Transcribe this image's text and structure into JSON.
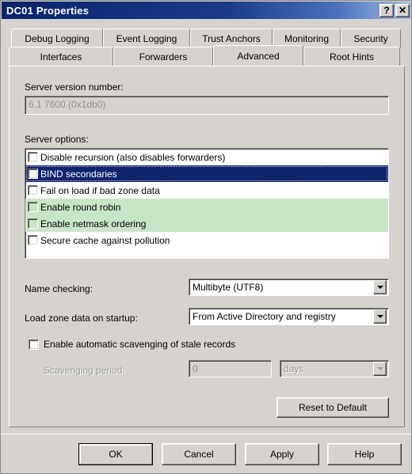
{
  "window": {
    "title": "DC01 Properties",
    "help_button": "?",
    "close_button": "✕"
  },
  "tabs": {
    "row1": [
      {
        "label": "Debug Logging",
        "active": false
      },
      {
        "label": "Event Logging",
        "active": false
      },
      {
        "label": "Trust Anchors",
        "active": false
      },
      {
        "label": "Monitoring",
        "active": false
      },
      {
        "label": "Security",
        "active": false
      }
    ],
    "row2": [
      {
        "label": "Interfaces",
        "active": false
      },
      {
        "label": "Forwarders",
        "active": false
      },
      {
        "label": "Advanced",
        "active": true
      },
      {
        "label": "Root Hints",
        "active": false
      }
    ],
    "active_tab": "Advanced"
  },
  "advanced": {
    "version_label": "Server version number:",
    "version_value": "6.1 7600 (0x1db0)",
    "options_label": "Server options:",
    "options": [
      {
        "label": "Disable recursion (also disables forwarders)",
        "checked": false,
        "state": "normal"
      },
      {
        "label": "BIND secondaries",
        "checked": false,
        "state": "selected"
      },
      {
        "label": "Fail on load if bad zone data",
        "checked": false,
        "state": "normal"
      },
      {
        "label": "Enable round robin",
        "checked": false,
        "state": "highlight"
      },
      {
        "label": "Enable netmask ordering",
        "checked": false,
        "state": "highlight"
      },
      {
        "label": "Secure cache against pollution",
        "checked": false,
        "state": "normal"
      }
    ],
    "name_checking_label": "Name checking:",
    "name_checking_value": "Multibyte (UTF8)",
    "load_zone_label": "Load zone data on startup:",
    "load_zone_value": "From Active Directory and registry",
    "scavenging_checkbox_label": "Enable automatic scavenging of stale records",
    "scavenging_checked": false,
    "scavenging_period_label": "Scavenging period:",
    "scavenging_period_value": "0",
    "scavenging_units_value": "days",
    "reset_button": "Reset to Default"
  },
  "footer": {
    "ok": "OK",
    "cancel": "Cancel",
    "apply": "Apply",
    "help": "Help"
  },
  "colors": {
    "titlebar_start": "#0a246a",
    "titlebar_end": "#a7bede",
    "dialog_face": "#d6d3ce",
    "selection_blue": "#10246e",
    "row_highlight_green": "#c8e6c5",
    "disabled_text": "#9a9a94"
  }
}
